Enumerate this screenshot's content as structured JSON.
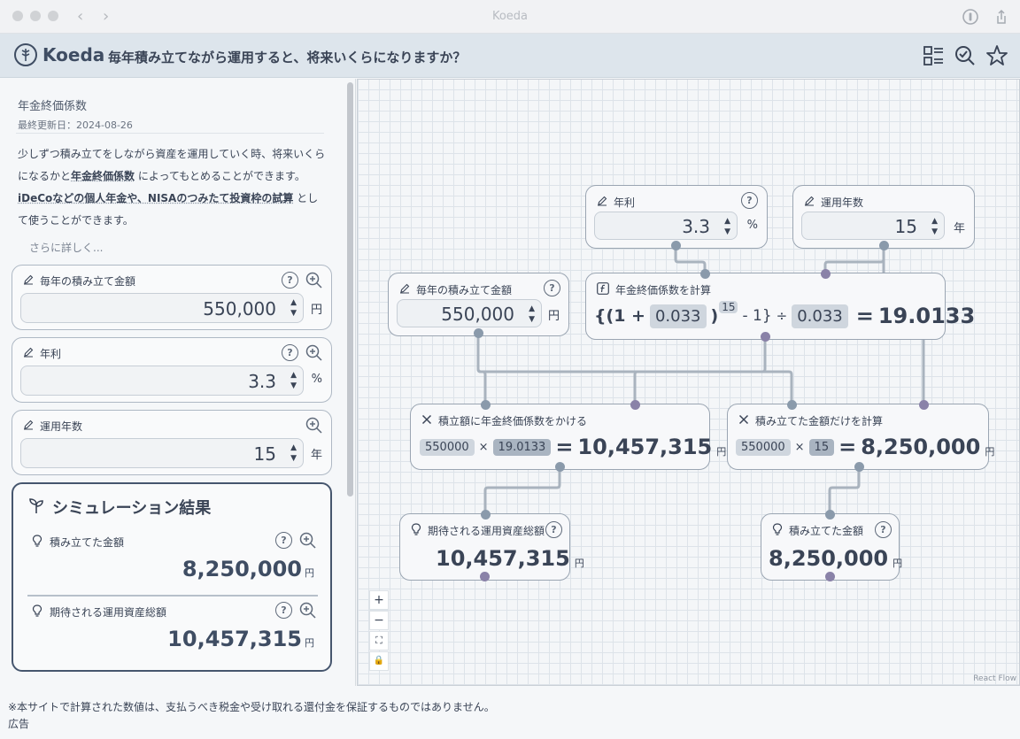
{
  "window": {
    "title": "Koeda"
  },
  "header": {
    "brand": "Koeda",
    "question": "毎年積み立てながら運用すると、将来いくらになりますか？"
  },
  "sidebar": {
    "title": "年金終価係数",
    "updated": "最終更新日：2024-08-26",
    "description": {
      "p1": "少しずつ積み立てをしながら資産を運用していく時、将来いくらになるかと",
      "term1": "年金終価係数",
      "p2": "によってもとめることができます。",
      "term2": "iDeCoなどの個人年金や、NISAのつみたて投資枠の試算",
      "p3": "として使うことができます。"
    },
    "more": "さらに詳しく...",
    "inputs": [
      {
        "label": "毎年の積み立て金額",
        "value": "550,000",
        "unit": "円"
      },
      {
        "label": "年利",
        "value": "3.3",
        "unit": "%"
      },
      {
        "label": "運用年数",
        "value": "15",
        "unit": "年"
      }
    ],
    "results": {
      "title": "シミュレーション結果",
      "items": [
        {
          "label": "積み立てた金額",
          "value": "8,250,000",
          "unit": "円"
        },
        {
          "label": "期待される運用資産総額",
          "value": "10,457,315",
          "unit": "円"
        }
      ]
    }
  },
  "flow": {
    "nodes": {
      "rate": {
        "label": "年利",
        "value": "3.3",
        "unit": "%"
      },
      "years": {
        "label": "運用年数",
        "value": "15",
        "unit": "年"
      },
      "annual": {
        "label": "毎年の積み立て金額",
        "value": "550,000",
        "unit": "円"
      },
      "coef": {
        "label": "年金終価係数を計算",
        "open": "{(1 +",
        "rate": "0.033",
        "close": ")",
        "exp": "15",
        "minus": "- 1}",
        "div": "÷",
        "rate2": "0.033",
        "eq": "=",
        "result": "19.0133"
      },
      "multiply": {
        "label": "積立額に年金終価係数をかける",
        "a": "550000",
        "op": "×",
        "b": "19.0133",
        "eq": "=",
        "result": "10,457,315",
        "unit": "円"
      },
      "contrib": {
        "label": "積み立てた金額だけを計算",
        "a": "550000",
        "op": "×",
        "b": "15",
        "eq": "=",
        "result": "8,250,000",
        "unit": "円"
      },
      "expected": {
        "label": "期待される運用資産総額",
        "value": "10,457,315",
        "unit": "円"
      },
      "total": {
        "label": "積み立てた金額",
        "value": "8,250,000",
        "unit": "円"
      }
    },
    "controls": {
      "zoom_in": "+",
      "zoom_out": "−",
      "fit": "⛶",
      "lock": "🔒"
    },
    "attribution": "React Flow"
  },
  "footer": {
    "disclaimer": "※本サイトで計算された数値は、支払うべき税金や受け取れる還付金を保証するものではありません。",
    "ad": "広告"
  },
  "colors": {
    "header_bg": "#dde5ec",
    "accent": "#3f4d63",
    "dot_gray": "#8a9aab",
    "dot_purple": "#8a82a8"
  }
}
